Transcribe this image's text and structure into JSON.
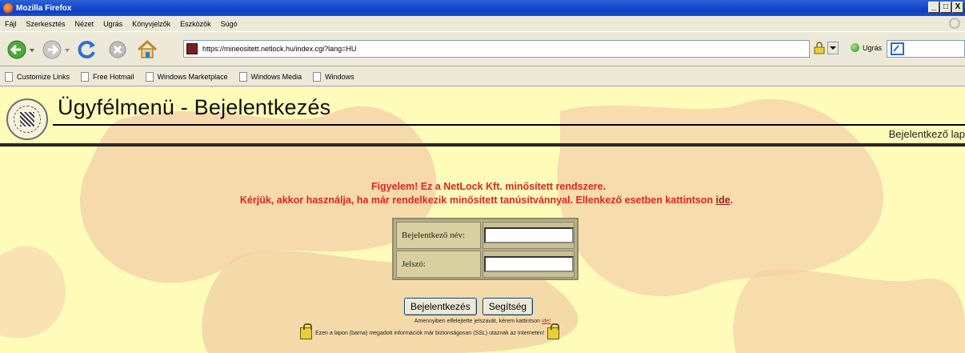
{
  "window": {
    "title": "Mozilla Firefox",
    "controls": [
      "_",
      "□",
      "X"
    ]
  },
  "menu": {
    "items": [
      "Fájl",
      "Szerkesztés",
      "Nézet",
      "Ugrás",
      "Könyvjelzők",
      "Eszközök",
      "Súgó"
    ]
  },
  "nav": {
    "url": "https://mineositett.netlock.hu/index.cgi?lang=HU",
    "go_label": "Ugrás"
  },
  "bookmarks": {
    "items": [
      "Customize Links",
      "Free Hotmail",
      "Windows Marketplace",
      "Windows Media",
      "Windows"
    ]
  },
  "page": {
    "title": "Ügyfélmenü - Bejelentkezés",
    "subnav_label": "Bejelentkező lap",
    "warning_line1": "Figyelem! Ez a NetLock Kft. minősített rendszere.",
    "warning_line2_prefix": "Kérjük, akkor használja, ha már rendelkezik minősített tanúsítvánnyal. Ellenkező esetben kattintson ",
    "warning_link": "ide",
    "warning_line2_suffix": ".",
    "login": {
      "username_label": "Bejelentkező név:",
      "password_label": "Jelszó:"
    },
    "buttons": {
      "login": "Bejelentkezés",
      "help": "Segítség"
    },
    "forgot_prefix": "Amennyiben elfelejtette jelszavát, kérem kattintson ",
    "forgot_link": "ide!",
    "ssl_notice": "Ezen a lapon (barna) megadott információk már biztonságosan (SSL) utaznak az Interneten!"
  },
  "colors": {
    "page_bg": "#fffbb8",
    "warning": "#e02424",
    "table_bg": "#b8b08a",
    "xp_blue": "#0d3fc6"
  }
}
